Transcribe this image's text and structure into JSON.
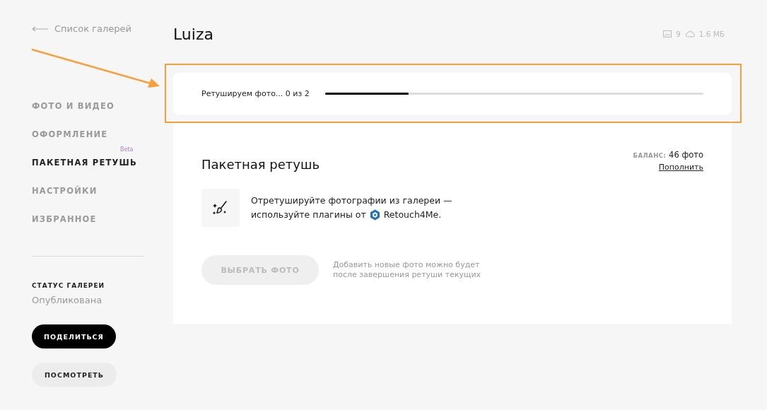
{
  "back_link": "Список галерей",
  "nav": [
    {
      "label": "ФОТО И ВИДЕО",
      "selected": false
    },
    {
      "label": "ОФОРМЛЕНИЕ",
      "selected": false
    },
    {
      "label": "ПАКЕТНАЯ РЕТУШЬ",
      "selected": true,
      "badge": "Beta"
    },
    {
      "label": "НАСТРОЙКИ",
      "selected": false
    },
    {
      "label": "ИЗБРАННОЕ",
      "selected": false
    }
  ],
  "status": {
    "label": "СТАТУС ГАЛЕРЕИ",
    "value": "Опубликована"
  },
  "share_button": "ПОДЕЛИТЬСЯ",
  "view_button": "ПОСМОТРЕТЬ",
  "title": "Luiza",
  "stats": {
    "photos": "9",
    "size": "1.6 МБ"
  },
  "progress": {
    "label": "Ретушируем фото... 0 из 2",
    "level": 0.22
  },
  "retouch": {
    "heading": "Пакетная ретушь",
    "balance_label": "БАЛАНС:",
    "balance_value": "46 фото",
    "top_up": "Пополнить",
    "description_line_1": "Отретушируйте фотографии из галереи —",
    "description_line_2": "используйте плагины от",
    "brand": "Retouch4Me.",
    "select_button": {
      "label": "ВЫБРАТЬ ФОТО",
      "disabled": true
    },
    "hint": "Добавить новые фото можно будет после завершения ретуши текущих"
  }
}
